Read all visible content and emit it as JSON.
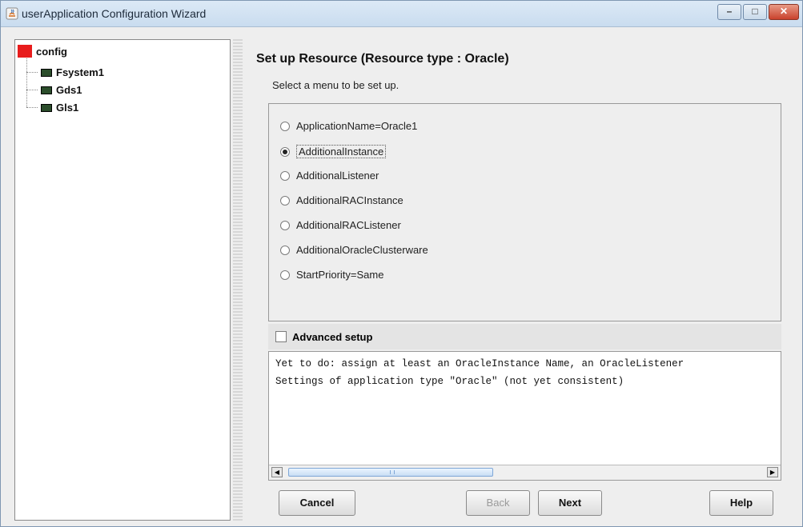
{
  "window": {
    "title": "userApplication Configuration Wizard",
    "minimize_glyph": "–",
    "maximize_glyph": "□",
    "close_glyph": "✕"
  },
  "tree": {
    "root": "config",
    "children": [
      "Fsystem1",
      "Gds1",
      "Gls1"
    ]
  },
  "main": {
    "heading": "Set up Resource (Resource type : Oracle)",
    "subheading": "Select a menu to be set up.",
    "options": [
      "ApplicationName=Oracle1",
      "AdditionalInstance",
      "AdditionalListener",
      "AdditionalRACInstance",
      "AdditionalRACListener",
      "AdditionalOracleClusterware",
      "StartPriority=Same"
    ],
    "selected_index": 1,
    "advanced_label": "Advanced setup",
    "advanced_checked": false,
    "messages": [
      "Yet to do: assign at least an OracleInstance Name, an OracleListener",
      "Settings of application type \"Oracle\" (not yet consistent)"
    ]
  },
  "buttons": {
    "cancel": "Cancel",
    "back": "Back",
    "next": "Next",
    "help": "Help"
  }
}
